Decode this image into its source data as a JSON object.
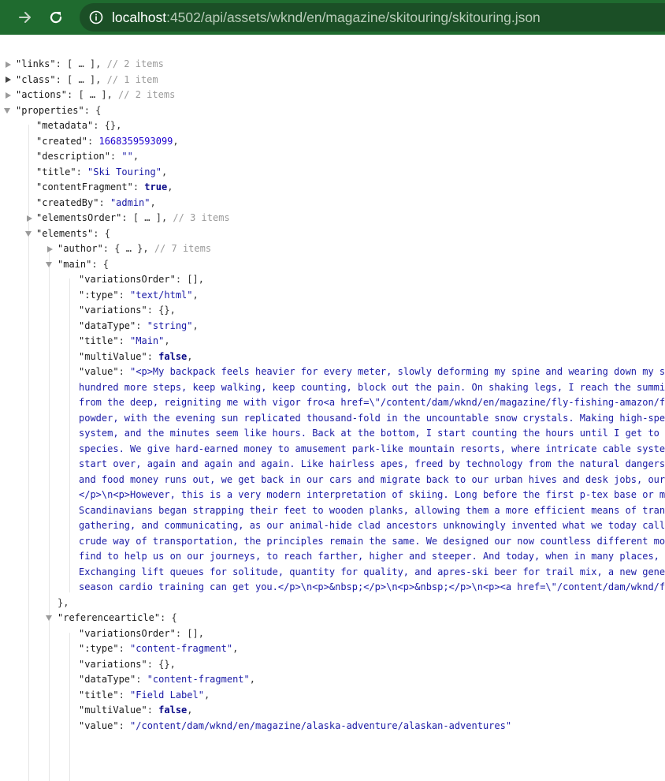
{
  "browser": {
    "url_host": "localhost",
    "url_path": ":4502/api/assets/wknd/en/magazine/skitouring/skitouring.json"
  },
  "icons": [
    "forward-arrow-icon",
    "reload-icon",
    "info-icon",
    "triangle-collapsed-icon",
    "triangle-expanded-icon"
  ],
  "json": {
    "links": {
      "key": "\"links\"",
      "val": ": [ … ],",
      "comment": " // 2 items"
    },
    "class": {
      "key": "\"class\"",
      "val": ": [ … ],",
      "comment": " // 1 item"
    },
    "actions": {
      "key": "\"actions\"",
      "val": ": [ … ],",
      "comment": " // 2 items"
    },
    "properties": {
      "open": {
        "key": "\"properties\"",
        "val": ": {"
      },
      "metadata": {
        "key": "\"metadata\"",
        "val": ": {},"
      },
      "created": {
        "key": "\"created\"",
        "p1": ": ",
        "val": "1668359593099",
        "p2": ","
      },
      "description": {
        "key": "\"description\"",
        "p1": ": ",
        "val": "\"\"",
        "p2": ","
      },
      "title": {
        "key": "\"title\"",
        "p1": ": ",
        "val": "\"Ski Touring\"",
        "p2": ","
      },
      "contentFragment": {
        "key": "\"contentFragment\"",
        "p1": ": ",
        "val": "true",
        "p2": ","
      },
      "createdBy": {
        "key": "\"createdBy\"",
        "p1": ": ",
        "val": "\"admin\"",
        "p2": ","
      },
      "elementsOrder": {
        "key": "\"elementsOrder\"",
        "val": ": [ … ],",
        "comment": " // 3 items"
      },
      "elements": {
        "open": {
          "key": "\"elements\"",
          "val": ": {"
        },
        "author": {
          "key": "\"author\"",
          "val": ": { … },",
          "comment": " // 7 items"
        },
        "main": {
          "open": {
            "key": "\"main\"",
            "val": ": {"
          },
          "variationsOrder": {
            "key": "\"variationsOrder\"",
            "val": ": [],"
          },
          "type": {
            "key": "\":type\"",
            "p1": ": ",
            "val": "\"text/html\"",
            "p2": ","
          },
          "variations": {
            "key": "\"variations\"",
            "val": ": {},"
          },
          "dataType": {
            "key": "\"dataType\"",
            "p1": ": ",
            "val": "\"string\"",
            "p2": ","
          },
          "title": {
            "key": "\"title\"",
            "p1": ": ",
            "val": "\"Main\"",
            "p2": ","
          },
          "multiValue": {
            "key": "\"multiValue\"",
            "p1": ": ",
            "val": "false",
            "p2": ","
          },
          "value": {
            "key": "\"value\"",
            "p1": ": ",
            "lines": [
              "\"<p>My backpack feels heavier for every meter, slowly deforming my spine and wearing down my sh",
              "hundred more steps, keep walking, keep counting, block out the pain. On shaking legs, I reach the summit",
              "from the deep, reigniting me with vigor fro<a href=\\\"/content/dam/wknd/en/magazine/fly-fishing-amazon/fl",
              "powder, with the evening sun replicated thousand-fold in the uncountable snow crystals. Making high-spee",
              "system, and the minutes seem like hours. Back at the bottom, I start counting the hours until I get to d",
              "species. We give hard-earned money to amusement park-like mountain resorts, where intricate cable system",
              "start over, again and again and again. Like hairless apes, freed by technology from the natural dangers",
              "and food money runs out, we get back in our cars and migrate back to our urban hives and desk jobs, our",
              "</p>\\n<p>However, this is a very modern interpretation of skiing. Long before the first p-tex base or me",
              "Scandinavians began strapping their feet to wooden planks, allowing them a more efficient means of trans",
              "gathering, and communicating, as our animal-hide clad ancestors unknowingly invented what we today call",
              "crude way of transportation, the principles remain the same. We designed our now countless different mod",
              "find to help us on our journeys, to reach farther, higher and steeper. And today, when in many places, m",
              "Exchanging lift queues for solitude, quantity for quality, and apres-ski beer for trail mix, a new gener",
              "season cardio training can get you.</p>\\n<p>&nbsp;</p>\\n<p>&nbsp;</p>\\n<p><a href=\\\"/content/dam/wknd/fr"
            ]
          },
          "close": "},"
        },
        "referencearticle": {
          "open": {
            "key": "\"referencearticle\"",
            "val": ": {"
          },
          "variationsOrder": {
            "key": "\"variationsOrder\"",
            "val": ": [],"
          },
          "type": {
            "key": "\":type\"",
            "p1": ": ",
            "val": "\"content-fragment\"",
            "p2": ","
          },
          "variations": {
            "key": "\"variations\"",
            "val": ": {},"
          },
          "dataType": {
            "key": "\"dataType\"",
            "p1": ": ",
            "val": "\"content-fragment\"",
            "p2": ","
          },
          "title": {
            "key": "\"title\"",
            "p1": ": ",
            "val": "\"Field Label\"",
            "p2": ","
          },
          "multiValue": {
            "key": "\"multiValue\"",
            "p1": ": ",
            "val": "false",
            "p2": ","
          },
          "value": {
            "key": "\"value\"",
            "p1": ": ",
            "val": "\"/content/dam/wknd/en/magazine/alaska-adventure/alaskan-adventures\""
          }
        }
      }
    }
  }
}
